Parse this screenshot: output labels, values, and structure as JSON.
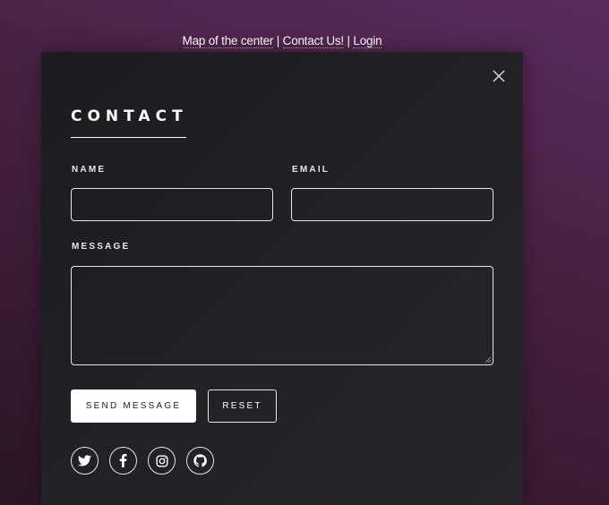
{
  "top_nav": {
    "links": [
      {
        "label": "Map of the center"
      },
      {
        "label": "Contact Us!"
      },
      {
        "label": "Login"
      }
    ],
    "separator": "|"
  },
  "contact": {
    "title": "CONTACT",
    "name_label": "NAME",
    "email_label": "EMAIL",
    "message_label": "MESSAGE",
    "name_value": "",
    "email_value": "",
    "message_value": "",
    "send_label": "SEND MESSAGE",
    "reset_label": "RESET"
  },
  "social": [
    {
      "icon": "twitter-icon"
    },
    {
      "icon": "facebook-icon"
    },
    {
      "icon": "instagram-icon"
    },
    {
      "icon": "github-icon"
    }
  ],
  "colors": {
    "background_accent": "#5a2a5c",
    "panel": "#1f1f23",
    "primary_button": "#ffffff"
  }
}
